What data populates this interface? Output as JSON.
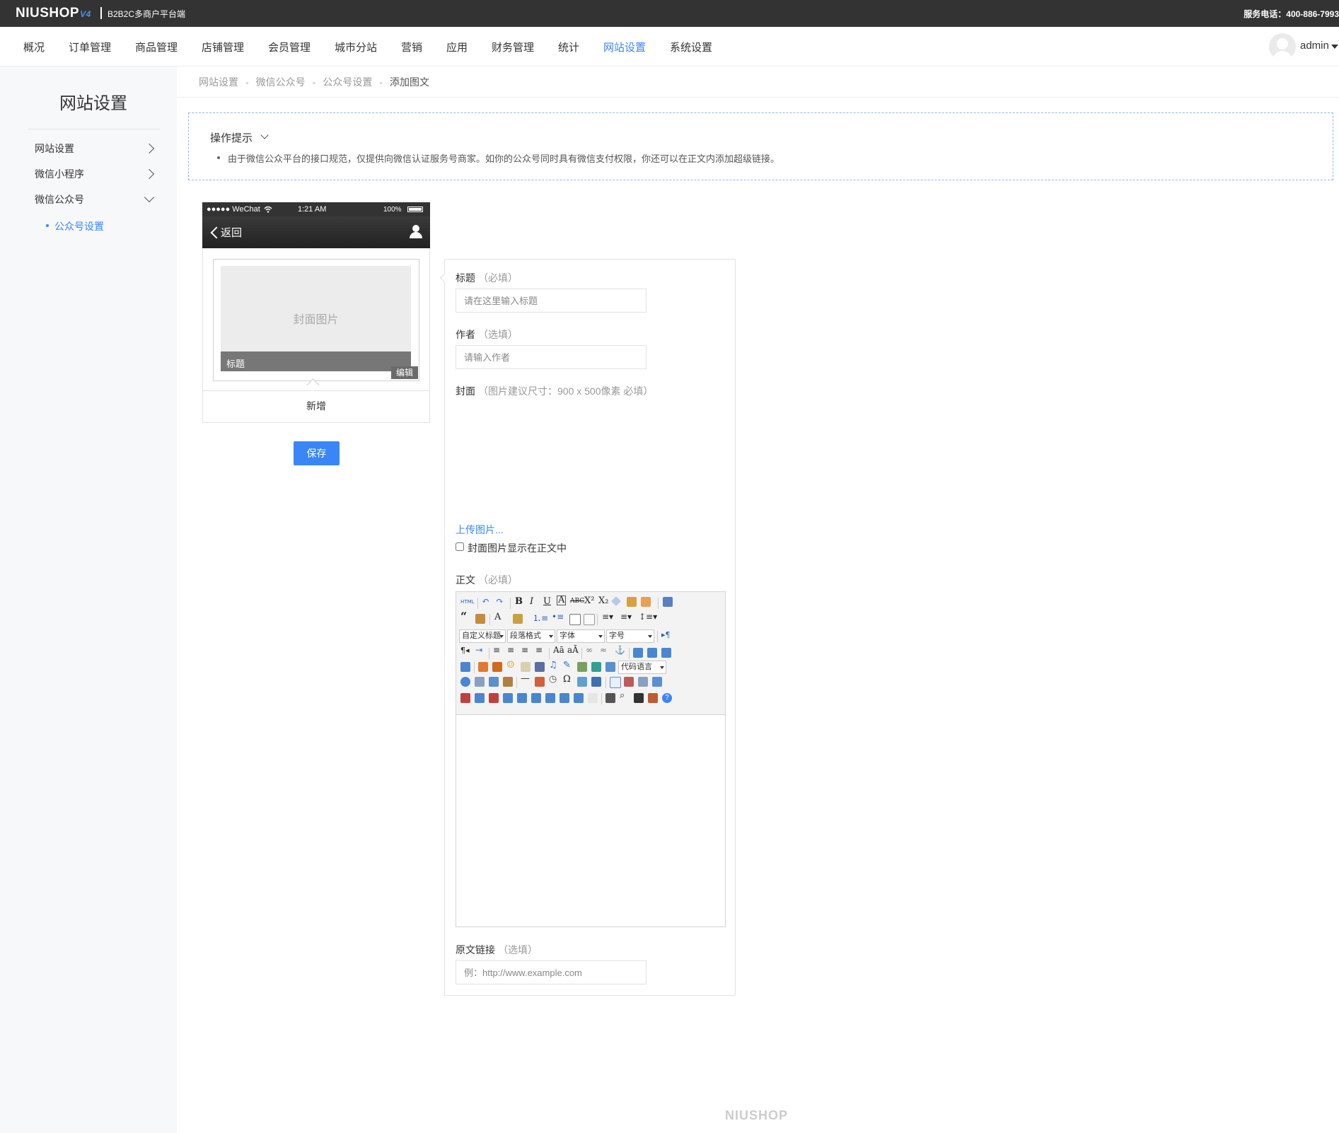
{
  "brand": {
    "name": "NIUSHOP",
    "version": "V4",
    "subtitle": "B2B2C多商户平台端"
  },
  "hotline": "服务电话：400-886-7993",
  "nav": {
    "items": [
      "概况",
      "订单管理",
      "商品管理",
      "店铺管理",
      "会员管理",
      "城市分站",
      "营销",
      "应用",
      "财务管理",
      "统计",
      "网站设置",
      "系统设置"
    ],
    "active": "网站设置",
    "user": "admin"
  },
  "sidebar": {
    "title": "网站设置",
    "items": [
      "网站设置",
      "微信小程序",
      "微信公众号"
    ],
    "sub_item": "公众号设置"
  },
  "breadcrumb": [
    "网站设置",
    "微信公众号",
    "公众号设置",
    "添加图文"
  ],
  "tips": {
    "title": "操作提示",
    "text": "由于微信公众平台的接口规范，仅提供向微信认证服务号商家。如你的公众号同时具有微信支付权限，你还可以在正文内添加超级链接。"
  },
  "phone": {
    "carrier": "●●●●● WeChat",
    "time": "1:21 AM",
    "battery": "100%",
    "back": "返回",
    "cover_placeholder": "封面图片",
    "title_placeholder": "标题",
    "edit": "编辑",
    "add": "新增"
  },
  "save_button": "保存",
  "form": {
    "title_label": "标题",
    "title_hint": "（必填）",
    "title_placeholder": "请在这里输入标题",
    "author_label": "作者",
    "author_hint": "（选填）",
    "author_placeholder": "请输入作者",
    "cover_label": "封面",
    "cover_hint": "（图片建议尺寸：900 x 500像素 必填）",
    "upload": "上传图片...",
    "show_cover": "封面图片显示在正文中",
    "show_cover_checked": false,
    "body_label": "正文",
    "body_hint": "（必填）",
    "link_label": "原文链接",
    "link_hint": "（选填）",
    "link_placeholder": "例：http://www.example.com"
  },
  "editor": {
    "selects": [
      "自定义标题",
      "段落格式",
      "字体",
      "字号",
      "代码语言"
    ]
  },
  "footer": "NIUSHOP"
}
